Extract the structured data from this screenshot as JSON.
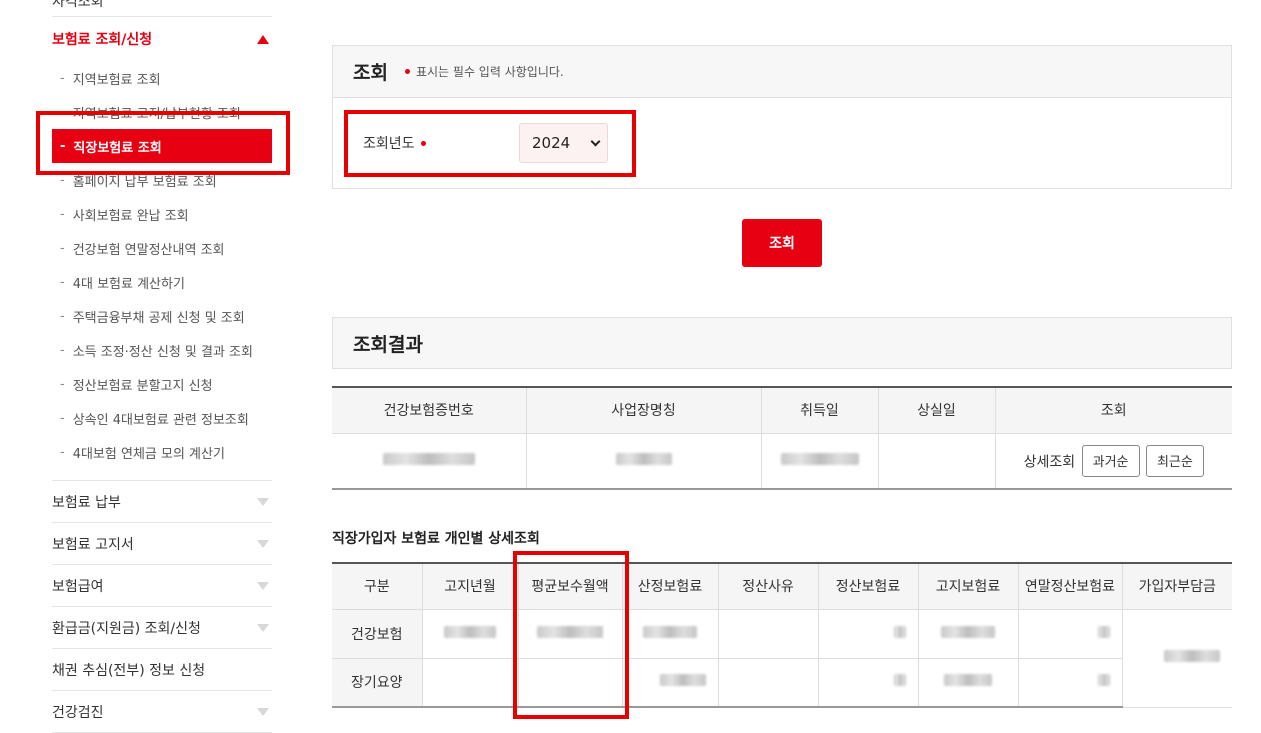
{
  "sidebar": {
    "top_cut_label": "자격조회",
    "active_menu": {
      "label": "보험료 조회/신청"
    },
    "sub_items": [
      {
        "label": "지역보험료 조회"
      },
      {
        "label": "지역보험료 고지/납부현황 조회"
      },
      {
        "label": "직장보험료 조회"
      },
      {
        "label": "홈페이지 납부 보험료 조회"
      },
      {
        "label": "사회보험료 완납 조회"
      },
      {
        "label": "건강보험 연말정산내역 조회"
      },
      {
        "label": "4대 보험료 계산하기"
      },
      {
        "label": "주택금융부채 공제 신청 및 조회"
      },
      {
        "label": "소득 조정·정산 신청 및 결과 조회"
      },
      {
        "label": "정산보험료 분할고지 신청"
      },
      {
        "label": "상속인 4대보험료 관련 정보조회"
      },
      {
        "label": "4대보험 연체금 모의 계산기"
      }
    ],
    "other_menus": [
      {
        "label": "보험료 납부"
      },
      {
        "label": "보험료 고지서"
      },
      {
        "label": "보험급여"
      },
      {
        "label": "환급금(지원금) 조회/신청"
      },
      {
        "label": "채권 추심(전부) 정보 신청"
      },
      {
        "label": "건강검진"
      }
    ]
  },
  "search": {
    "title": "조회",
    "required_note": "표시는 필수 입력 사항입니다.",
    "year_label": "조회년도",
    "year_value": "2024",
    "button_label": "조회"
  },
  "result": {
    "title": "조회결과",
    "columns": [
      "건강보험증번호",
      "사업장명칭",
      "취득일",
      "상실일",
      "조회"
    ],
    "detail_label": "상세조회",
    "order_past": "과거순",
    "order_recent": "최근순"
  },
  "detail": {
    "title": "직장가입자 보험료 개인별 상세조회",
    "columns": [
      "구분",
      "고지년월",
      "평균보수월액",
      "산정보험료",
      "정산사유",
      "정산보험료",
      "고지보험료",
      "연말정산보험료",
      "가입자부담금"
    ],
    "rows": [
      {
        "label": "건강보험"
      },
      {
        "label": "장기요양"
      }
    ]
  },
  "colors": {
    "accent": "#e60012",
    "annotation": "#e60000"
  }
}
